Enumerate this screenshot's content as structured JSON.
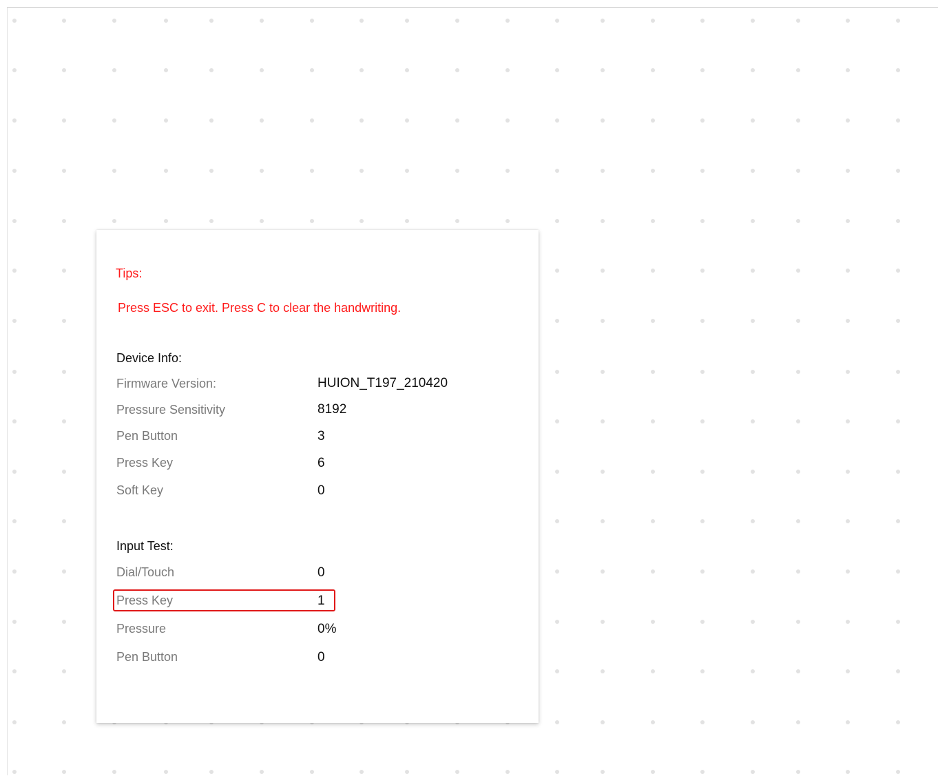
{
  "colors": {
    "tips": "#ff1a1a",
    "highlight_border": "#e01818",
    "label": "#7a7a7a",
    "value": "#111111",
    "grid_dot": "#e2e2e2"
  },
  "tips": {
    "title": "Tips:",
    "text": "Press ESC to exit. Press C to clear the handwriting."
  },
  "device_info": {
    "title": "Device Info:",
    "rows": [
      {
        "label": "Firmware Version:",
        "value": "HUION_T197_210420"
      },
      {
        "label": "Pressure Sensitivity",
        "value": "8192"
      },
      {
        "label": "Pen Button",
        "value": "3"
      },
      {
        "label": "Press Key",
        "value": "6"
      },
      {
        "label": "Soft Key",
        "value": "0"
      }
    ]
  },
  "input_test": {
    "title": "Input Test:",
    "rows": [
      {
        "label": "Dial/Touch",
        "value": "0"
      },
      {
        "label": "Press Key",
        "value": "1"
      },
      {
        "label": "Pressure",
        "value": "0%"
      },
      {
        "label": "Pen Button",
        "value": "0"
      }
    ]
  }
}
